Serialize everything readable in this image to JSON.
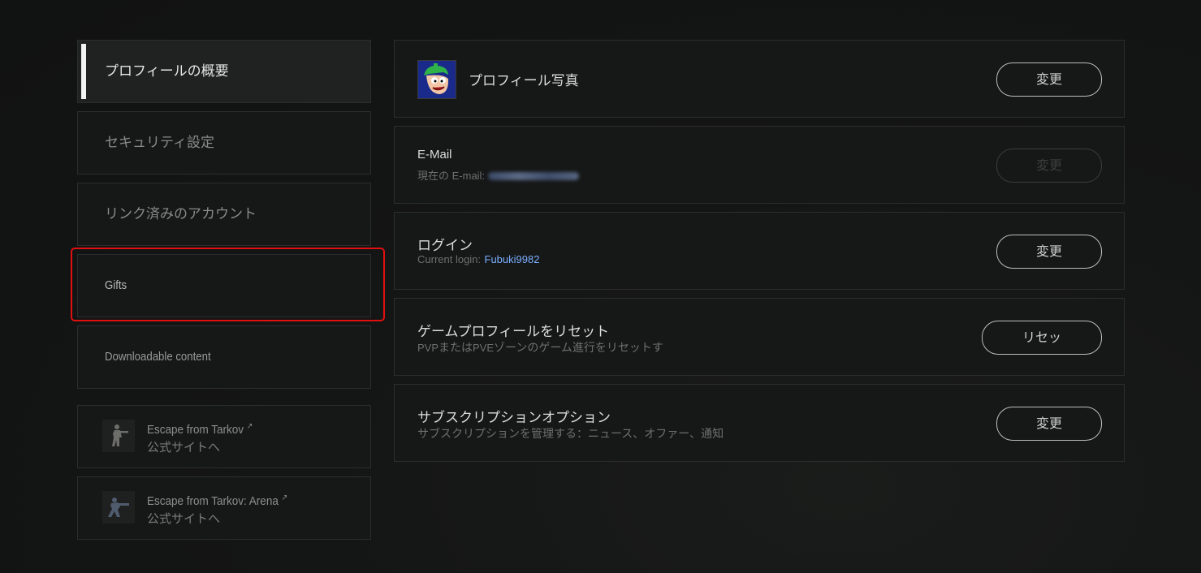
{
  "sidebar": {
    "items": [
      {
        "label": "プロフィールの概要",
        "active": true
      },
      {
        "label": "セキュリティ設定"
      },
      {
        "label": "リンク済みのアカウント"
      },
      {
        "label": "Gifts"
      },
      {
        "label": "Downloadable content"
      }
    ],
    "external": [
      {
        "title": "Escape from Tarkov",
        "sub": "公式サイトへ",
        "icon": "soldier-icon"
      },
      {
        "title": "Escape from Tarkov: Arena",
        "sub": "公式サイトへ",
        "icon": "soldier-aiming-icon"
      }
    ]
  },
  "panels": {
    "photo": {
      "title": "プロフィール写真",
      "button": "変更",
      "icon": "avatar-cartoon"
    },
    "email": {
      "title": "E-Mail",
      "sub_label": "現在の E-mail:",
      "button": "変更",
      "button_disabled": true
    },
    "login": {
      "title": "ログイン",
      "sub_label": "Current login:",
      "value": "Fubuki9982",
      "button": "変更"
    },
    "reset": {
      "title": "ゲームプロフィールをリセット",
      "sub_prefix": "PVP",
      "sub_mid": "または",
      "sub_mid2": "PVE",
      "sub_rest": "ゾーンのゲーム進行をリセットす",
      "button": "リセッ"
    },
    "subscription": {
      "title": "サブスクリプションオプション",
      "sub": "サブスクリプションを管理する：ニュース、オファー、通知",
      "button": "変更"
    }
  },
  "colors": {
    "accent_link": "#79b0ff",
    "highlight": "#e01010",
    "background": "#141515"
  }
}
